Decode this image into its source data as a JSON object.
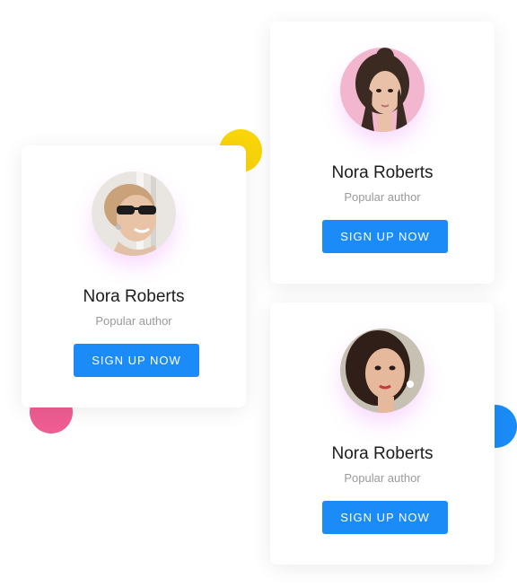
{
  "colors": {
    "accent": "#1b8cf7",
    "deco_yellow": "#f9d50a",
    "deco_pink": "#ef5d93",
    "deco_blue": "#1b8cf7"
  },
  "cards": [
    {
      "name": "Nora Roberts",
      "role": "Popular author",
      "button_label": "SIGN UP NOW",
      "avatar_icon": "woman-with-sunglasses-avatar"
    },
    {
      "name": "Nora Roberts",
      "role": "Popular author",
      "button_label": "SIGN UP NOW",
      "avatar_icon": "woman-pink-background-avatar"
    },
    {
      "name": "Nora Roberts",
      "role": "Popular author",
      "button_label": "SIGN UP NOW",
      "avatar_icon": "woman-dark-hair-avatar"
    }
  ]
}
